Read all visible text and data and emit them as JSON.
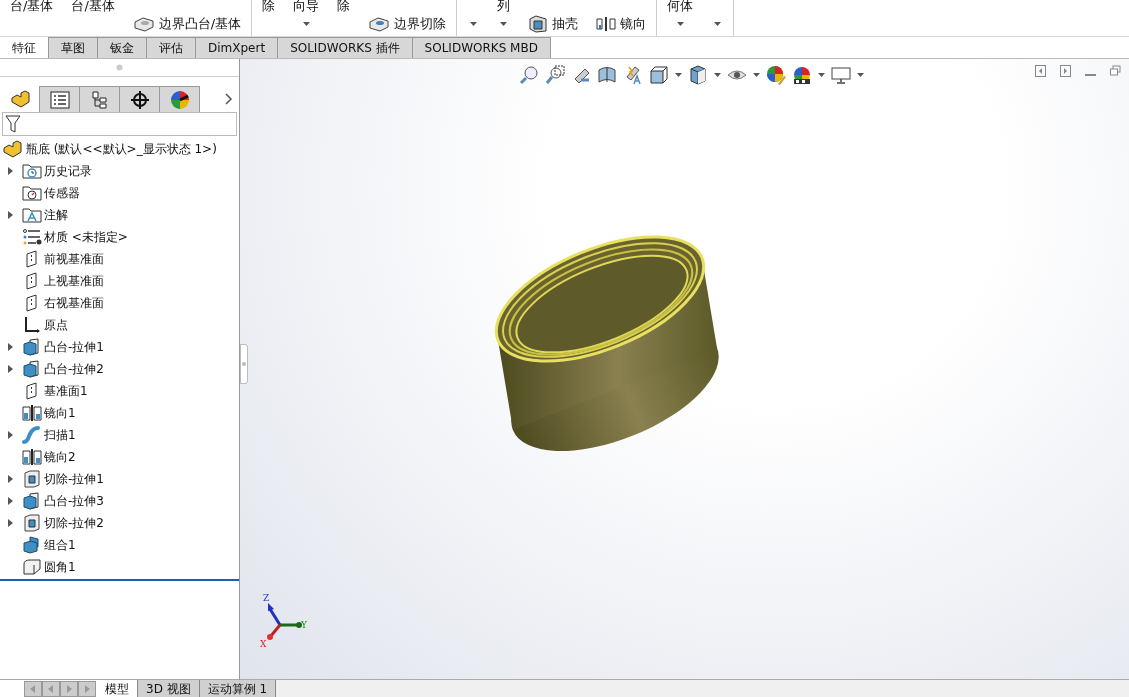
{
  "ribbon": {
    "groups": [
      [
        {
          "top": "台/基体"
        },
        {
          "top": "台/基体"
        },
        {
          "bottom": "边界凸台/基体",
          "kind": "boss"
        }
      ],
      [
        {
          "top": "除"
        },
        {
          "top": "向导",
          "caret": true
        },
        {
          "top": "除"
        },
        {
          "bottom": "边界切除",
          "kind": "cut"
        }
      ],
      [
        {
          "caret": true
        },
        {
          "top": "列",
          "caret": true
        },
        {
          "bottom": "抽壳",
          "kind": "shell"
        },
        {
          "bottom": "镜向",
          "kind": "mirror"
        }
      ],
      [
        {
          "top": "何体",
          "caret": true
        },
        {
          "caret": true
        }
      ]
    ]
  },
  "tabs": [
    {
      "label": "特征",
      "selected": true
    },
    {
      "label": "草图",
      "selected": false
    },
    {
      "label": "钣金",
      "selected": false
    },
    {
      "label": "评估",
      "selected": false
    },
    {
      "label": "DimXpert",
      "selected": false
    },
    {
      "label": "SOLIDWORKS 插件",
      "selected": false
    },
    {
      "label": "SOLIDWORKS MBD",
      "selected": false
    }
  ],
  "panel_tabs": [
    {
      "kind": "feature",
      "selected": true
    },
    {
      "kind": "property",
      "selected": false
    },
    {
      "kind": "config",
      "selected": false
    },
    {
      "kind": "dimxpert",
      "selected": false
    },
    {
      "kind": "display",
      "selected": false
    }
  ],
  "tree": {
    "root": "瓶底 (默认<<默认>_显示状态 1>)",
    "items": [
      {
        "label": "历史记录",
        "kind": "history",
        "has_children": true
      },
      {
        "label": "传感器",
        "kind": "sensor",
        "has_children": false
      },
      {
        "label": "注解",
        "kind": "annotation",
        "has_children": true
      },
      {
        "label": "材质 <未指定>",
        "kind": "material",
        "has_children": false
      },
      {
        "label": "前视基准面",
        "kind": "plane",
        "has_children": false
      },
      {
        "label": "上视基准面",
        "kind": "plane",
        "has_children": false
      },
      {
        "label": "右视基准面",
        "kind": "plane",
        "has_children": false
      },
      {
        "label": "原点",
        "kind": "origin",
        "has_children": false
      },
      {
        "label": "凸台-拉伸1",
        "kind": "extrude",
        "has_children": true
      },
      {
        "label": "凸台-拉伸2",
        "kind": "extrude",
        "has_children": true
      },
      {
        "label": "基准面1",
        "kind": "plane",
        "has_children": false
      },
      {
        "label": "镜向1",
        "kind": "mirror",
        "has_children": false
      },
      {
        "label": "扫描1",
        "kind": "sweep",
        "has_children": true
      },
      {
        "label": "镜向2",
        "kind": "mirror",
        "has_children": false
      },
      {
        "label": "切除-拉伸1",
        "kind": "cut",
        "has_children": true
      },
      {
        "label": "凸台-拉伸3",
        "kind": "extrude",
        "has_children": true
      },
      {
        "label": "切除-拉伸2",
        "kind": "cut",
        "has_children": true
      },
      {
        "label": "组合1",
        "kind": "combine",
        "has_children": false
      },
      {
        "label": "圆角1",
        "kind": "fillet",
        "has_children": false
      }
    ]
  },
  "triad": {
    "x": "X",
    "y": "Y",
    "z": "Z"
  },
  "bottom_tabs": [
    {
      "label": "模型",
      "selected": true
    },
    {
      "label": "3D 视图",
      "selected": false
    },
    {
      "label": "运动算例 1",
      "selected": false
    }
  ]
}
